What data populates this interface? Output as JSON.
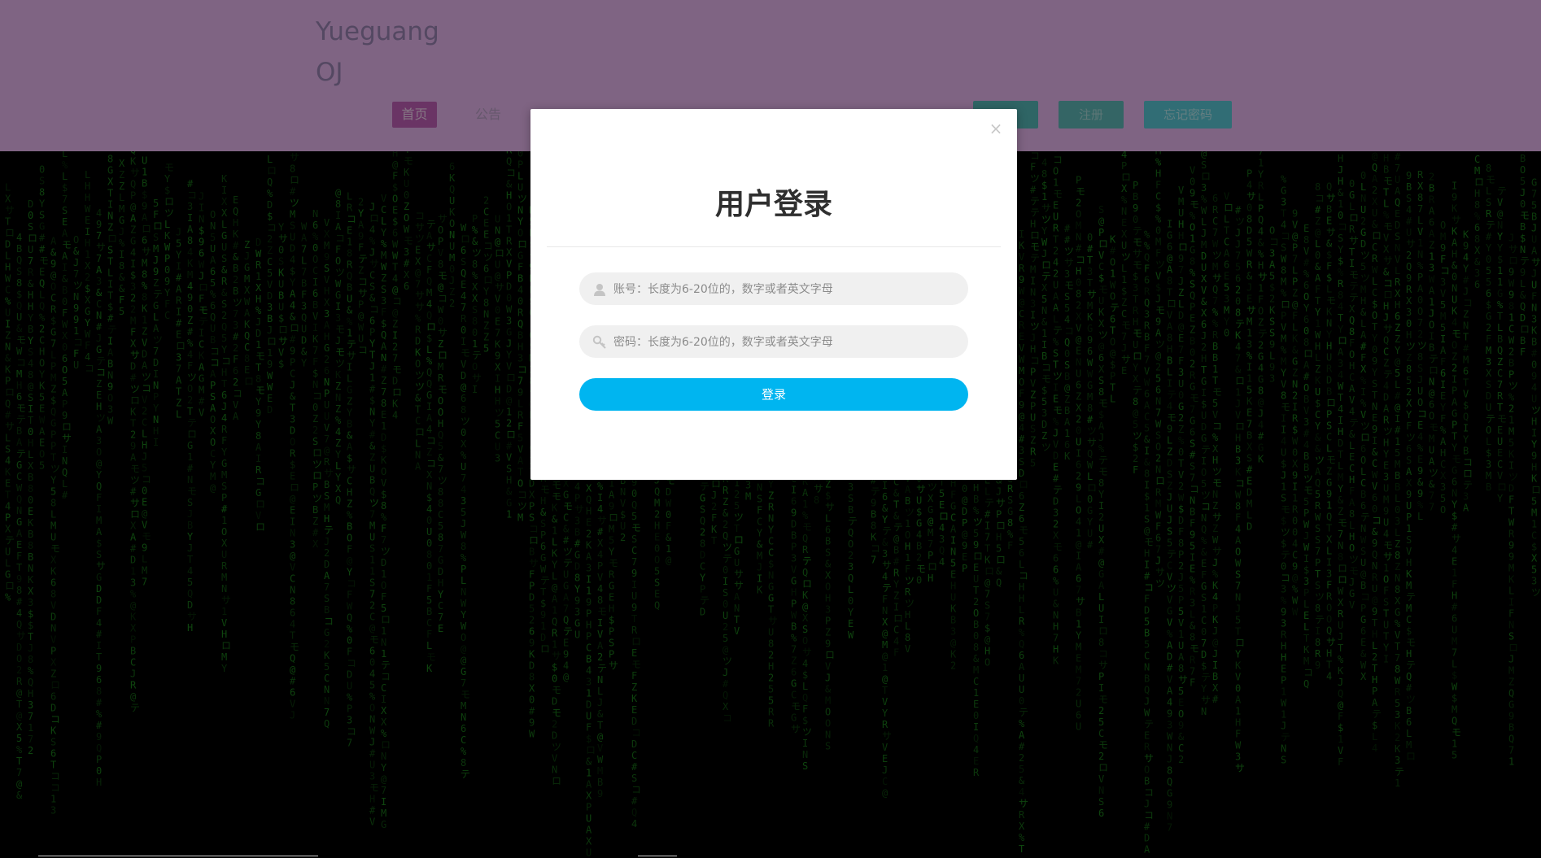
{
  "header": {
    "brand": "Yueguang OJ",
    "nav": {
      "home": "首页",
      "notice": "公告"
    },
    "actions": {
      "register": "注册",
      "forgot": "忘记密码"
    }
  },
  "login_modal": {
    "title": "用户登录",
    "close": "×",
    "username_placeholder": "账号：长度为6-20位的，数字或者英文字母",
    "password_placeholder": "密码：长度为6-20位的，数字或者英文字母",
    "submit": "登录"
  },
  "colors": {
    "header_bg": "#e8b7ee",
    "matrix_green": "#1f8f1f",
    "submit_blue": "#00b5f0",
    "register_btn": "#5fb8b8",
    "forgot_btn": "#5ac7d6"
  }
}
